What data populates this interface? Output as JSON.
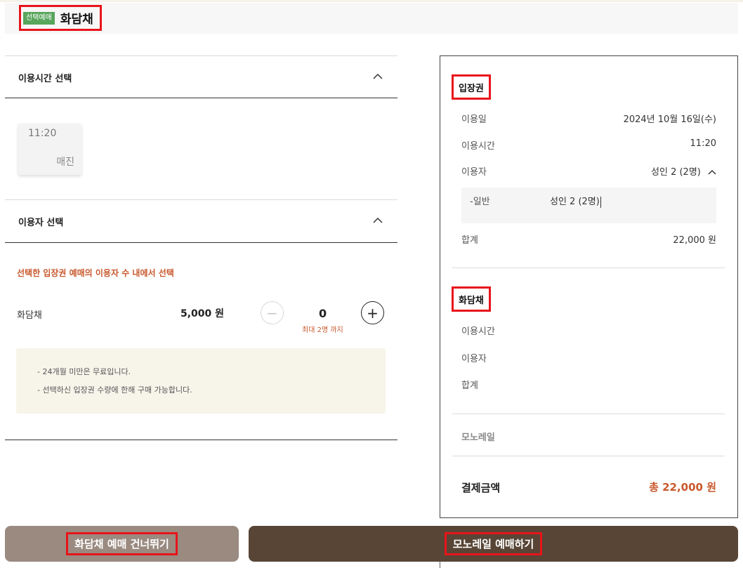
{
  "header": {
    "badge": "선택예매",
    "title": "화담채"
  },
  "time_section": {
    "title": "이용시간 선택",
    "slots": [
      {
        "time": "11:20",
        "status": "매진"
      }
    ]
  },
  "user_section": {
    "title": "이용자 선택",
    "notice": "선택한 입장권 예매의 이용자 수 내에서 선택",
    "item": {
      "name": "화담채",
      "price": "5,000 원",
      "quantity": "0",
      "max_note": "최대 2명 까지"
    },
    "info": [
      "-  24개월 미만은 무료입니다.",
      "-  선택하신 입장권 수량에 한해 구매 가능합니다."
    ]
  },
  "summary": {
    "ticket": {
      "title": "입장권",
      "date_label": "이용일",
      "date_value": "2024년 10월 16일(수)",
      "time_label": "이용시간",
      "time_value": "11:20",
      "user_label": "이용자",
      "user_value": "성인 2 (2명)",
      "sub_label": "-일반",
      "sub_value": "성인 2 (2명)",
      "total_label": "합계",
      "total_value": "22,000 원"
    },
    "hwadamchae": {
      "title": "화담채",
      "time_label": "이용시간",
      "user_label": "이용자",
      "total_label": "합계"
    },
    "monorail_label": "모노레일",
    "payment_label": "결제금액",
    "payment_value": "총 22,000 원"
  },
  "buttons": {
    "skip": "화담채 예매 건너뛰기",
    "next": "모노레일 예매하기"
  },
  "colors": {
    "accent": "#c8582c",
    "badge": "#58a55c",
    "next_button": "#584536",
    "skip_button": "#9a8a80"
  }
}
